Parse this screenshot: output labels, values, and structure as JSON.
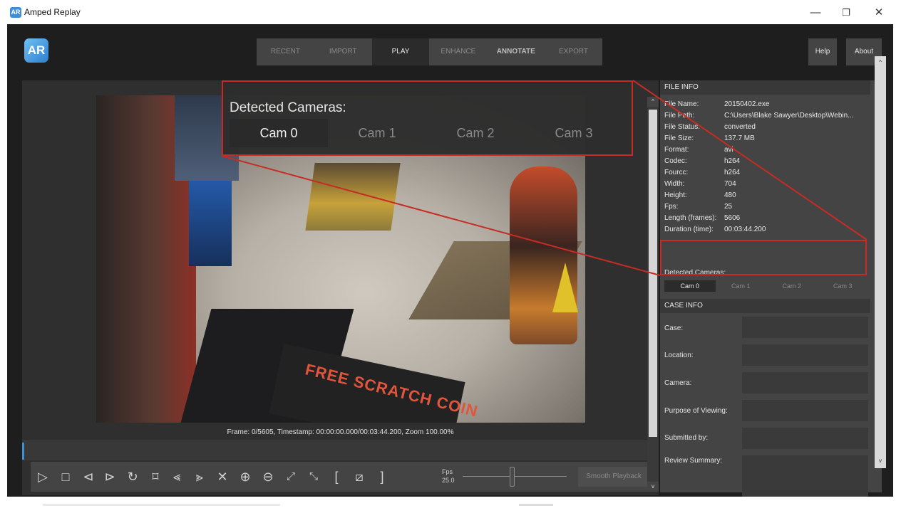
{
  "window": {
    "logo_text": "AR",
    "title": "Amped Replay",
    "minimize_glyph": "—",
    "restore_glyph": "❐",
    "close_glyph": "✕"
  },
  "app_logo_text": "AR",
  "nav": {
    "tabs": [
      {
        "label": "RECENT"
      },
      {
        "label": "IMPORT"
      },
      {
        "label": "PLAY"
      },
      {
        "label": "ENHANCE"
      },
      {
        "label": "ANNOTATE"
      },
      {
        "label": "EXPORT"
      }
    ],
    "help_label": "Help",
    "about_label": "About"
  },
  "video": {
    "board_text": "FREE SCRATCH COIN",
    "frame_info": "Frame: 0/5605, Timestamp: 00:00:00.000/00:03:44.200,  Zoom 100.00%"
  },
  "controls": {
    "icons": {
      "play": "▷",
      "stop": "□",
      "prev_frame": "⊲",
      "next_frame": "⊳",
      "loop": "↻",
      "bookmark": "⌑",
      "rewind": "⪡",
      "fast_forward": "⪢",
      "cancel": "✕",
      "zoom_in": "⊕",
      "zoom_out": "⊖",
      "expand": "⤢",
      "shrink": "⤡",
      "mark_in": "[",
      "clear_marks": "⧄",
      "mark_out": "]"
    },
    "fps_label": "Fps",
    "fps_value": "25.0",
    "fps_slider_level": 0.47,
    "smooth_label": "Smooth Playback"
  },
  "file_info": {
    "header": "FILE INFO",
    "rows": [
      {
        "k": "File Name:",
        "v": "20150402.exe"
      },
      {
        "k": "File Path:",
        "v": "C:\\Users\\Blake Sawyer\\Desktop\\Webin..."
      },
      {
        "k": "File Status:",
        "v": "converted"
      },
      {
        "k": "File Size:",
        "v": "137.7 MB"
      },
      {
        "k": "Format:",
        "v": "avi"
      },
      {
        "k": "Codec:",
        "v": "h264"
      },
      {
        "k": "Fourcc:",
        "v": "h264"
      },
      {
        "k": "Width:",
        "v": "704"
      },
      {
        "k": "Height:",
        "v": "480"
      },
      {
        "k": "Fps:",
        "v": "25"
      },
      {
        "k": "Length (frames):",
        "v": "5606"
      },
      {
        "k": "Duration (time):",
        "v": "00:03:44.200"
      }
    ],
    "detected_label": "Detected Cameras:",
    "cams": [
      "Cam 0",
      "Cam 1",
      "Cam 2",
      "Cam 3"
    ]
  },
  "case_info": {
    "header": "CASE INFO",
    "fields": [
      {
        "label": "Case:"
      },
      {
        "label": "Location:"
      },
      {
        "label": "Camera:"
      },
      {
        "label": "Purpose of Viewing:"
      },
      {
        "label": "Submitted by:"
      },
      {
        "label": "Review Summary:"
      }
    ]
  },
  "callout": {
    "title": "Detected Cameras:",
    "cams": [
      "Cam 0",
      "Cam 1",
      "Cam 2",
      "Cam 3"
    ]
  },
  "scroll_up": "^",
  "scroll_down": "v",
  "highlight_color": "#c62c24",
  "accent_color": "#3f8fd6"
}
